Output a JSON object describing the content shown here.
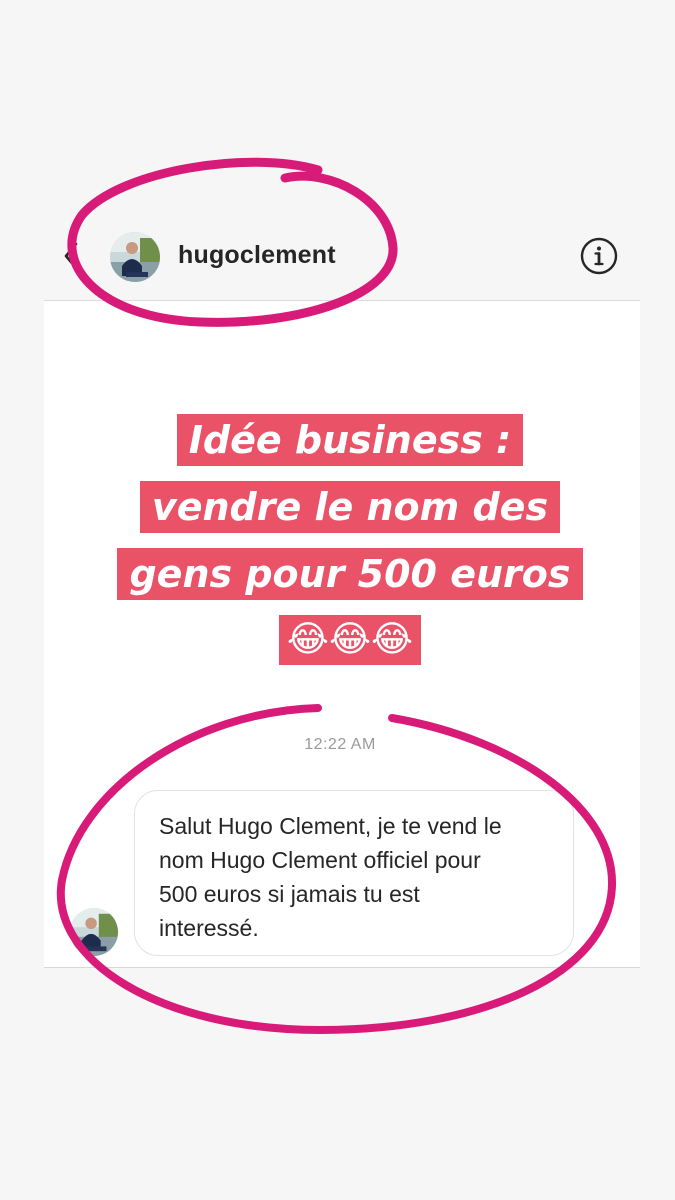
{
  "header": {
    "username": "hugoclement",
    "back_icon": "chevron-left-icon",
    "info_icon": "info-circle-icon"
  },
  "story_overlay": {
    "lines": [
      "Idée business :",
      "vendre le nom des",
      "gens pour 500 euros",
      "😂😂😂"
    ],
    "highlight_color": "#ea5268",
    "text_color": "#ffffff"
  },
  "conversation": {
    "timestamp": "12:22 AM",
    "message": {
      "lines": [
        "Salut Hugo Clement, je te vend le",
        "nom Hugo Clement officiel pour",
        "500 euros si jamais tu est",
        "interessé."
      ]
    }
  },
  "annotation": {
    "circle_color": "#d81b78"
  }
}
